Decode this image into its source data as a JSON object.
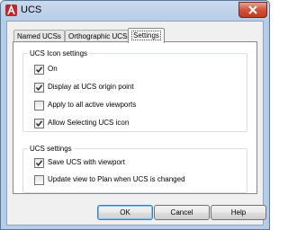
{
  "window": {
    "title": "UCS",
    "close_glyph": "×"
  },
  "tabs": [
    {
      "label": "Named UCSs",
      "active": false
    },
    {
      "label": "Orthographic UCSs",
      "active": false
    },
    {
      "label": "Settings",
      "active": true
    }
  ],
  "icon_settings": {
    "group_label": "UCS Icon settings",
    "options": [
      {
        "label": "On",
        "checked": true
      },
      {
        "label": "Display at UCS origin point",
        "checked": true
      },
      {
        "label": "Apply to all active viewports",
        "checked": false
      },
      {
        "label": "Allow Selecting UCS icon",
        "checked": true
      }
    ]
  },
  "ucs_settings": {
    "group_label": "UCS settings",
    "options": [
      {
        "label": "Save UCS with viewport",
        "checked": true
      },
      {
        "label": "Update view to Plan when UCS is changed",
        "checked": false
      }
    ]
  },
  "buttons": {
    "ok": "OK",
    "cancel": "Cancel",
    "help": "Help"
  },
  "colors": {
    "title_bar": "#c9daee",
    "close_button": "#c84a2e",
    "app_icon": "#c0262d"
  }
}
